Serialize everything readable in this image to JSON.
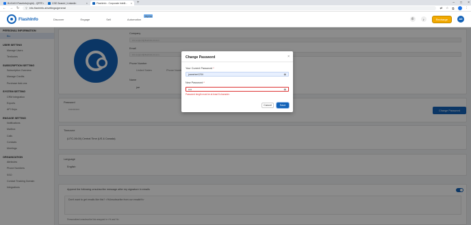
{
  "browser": {
    "tabs": [
      {
        "label": "BUG#19 FlashInfo(Light) - QPFF",
        "color": "#1a73e8"
      },
      {
        "label": "CSE Search | LinkedIn",
        "color": "#0a66c2"
      },
      {
        "label": "FlashInfo - Corporate Intelli...",
        "color": "#1463b8"
      }
    ],
    "new_tab": "+",
    "url": "info.flashinfo.ai/settings/general"
  },
  "header": {
    "logo_text": "FlashInfo",
    "nav": [
      "Discover",
      "Engage",
      "Sell",
      "Automation"
    ],
    "beta_badge": "Alpha",
    "recharge_label": "Recharge",
    "avatar_initials": "AD"
  },
  "sidebar": {
    "groups": [
      {
        "title": "PERSONAL INFORMATION",
        "items": [
          "Bio"
        ]
      },
      {
        "title": "USER SETTING",
        "items": [
          "Manage Users",
          "Territories"
        ]
      },
      {
        "title": "SUBSCRIPTION SETTING",
        "items": [
          "Subscription Overview",
          "Manage Credits",
          "Purchase Add-ons"
        ]
      },
      {
        "title": "SYSTEM SETTING",
        "items": [
          "CRM Integration",
          "Exports",
          "API Keys"
        ]
      },
      {
        "title": "ENGAGE SETTING",
        "items": [
          "Notifications",
          "Mailbox",
          "Calls",
          "Contacts",
          "Meetings"
        ]
      },
      {
        "title": "ORGANIZATION",
        "items": [
          "Attributes",
          "Phone Numbers",
          "SSO",
          "Contact Tracking Domain",
          "Integrations"
        ]
      }
    ],
    "active_item": "Bio"
  },
  "profile": {
    "company_label": "Company",
    "company_value": "info.support@flashinfo.ai.com",
    "email_label": "Email",
    "email_value": "info.support@flashinfo.ai.com",
    "phone_label": "Phone Number",
    "phone_country": "United States",
    "phone_placeholder": "Phone Number",
    "name_label": "Name",
    "name_value": "joe"
  },
  "password_section": {
    "label": "Password",
    "masked": "••••••••••••",
    "change_button": "Change Password"
  },
  "timezone_section": {
    "label": "Timezone",
    "value": "(UTC-06:00) Central Time (US & Canada)"
  },
  "language_section": {
    "label": "Language",
    "value": "English"
  },
  "signature_section": {
    "toggle_label": "Append the following unsubscribe message after my signature in emails",
    "message": "Don't want to get emails like this? <%Unsubscribe from our emails%>",
    "hint": "Personalized unsubscribe link wrapped in <% and %>"
  },
  "modal": {
    "title": "Change Password",
    "close": "×",
    "current_label": "Your Current Password",
    "current_value": "joansher1234",
    "new_label": "New Password",
    "new_value": "••••",
    "required_mark": "*",
    "error_text": "Password length must be at least 8 character.",
    "cancel_label": "Cancel",
    "save_label": "Save"
  }
}
